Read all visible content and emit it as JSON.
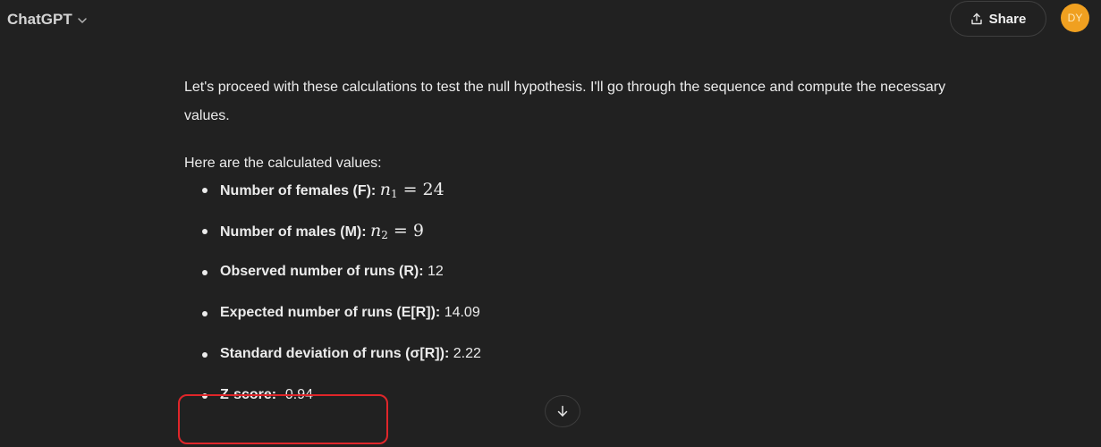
{
  "header": {
    "model_label": "ChatGPT",
    "share_label": "Share",
    "avatar_initials": "DY"
  },
  "message": {
    "intro": "Let's proceed with these calculations to test the null hypothesis. I'll go through the sequence and compute the necessary values.",
    "values_heading": "Here are the calculated values:",
    "items": [
      {
        "label": "Number of females (F):",
        "math_var": "n",
        "math_sub": "1",
        "math_op": "=",
        "math_val": "24"
      },
      {
        "label": "Number of males (M):",
        "math_var": "n",
        "math_sub": "2",
        "math_op": "=",
        "math_val": "9"
      },
      {
        "label": "Observed number of runs (R):",
        "value": "12"
      },
      {
        "label": "Expected number of runs (E[R]):",
        "value": "14.09"
      },
      {
        "label": "Standard deviation of runs (σ[R]):",
        "value": "2.22"
      },
      {
        "label": "Z-score:",
        "value": "-0.94"
      }
    ]
  },
  "colors": {
    "background": "#212121",
    "avatar": "#f0a020",
    "highlight_border": "#e0262a"
  },
  "icons": {
    "model_chevron": "chevron-down-icon",
    "share": "share-icon",
    "scroll": "arrow-down-icon"
  }
}
